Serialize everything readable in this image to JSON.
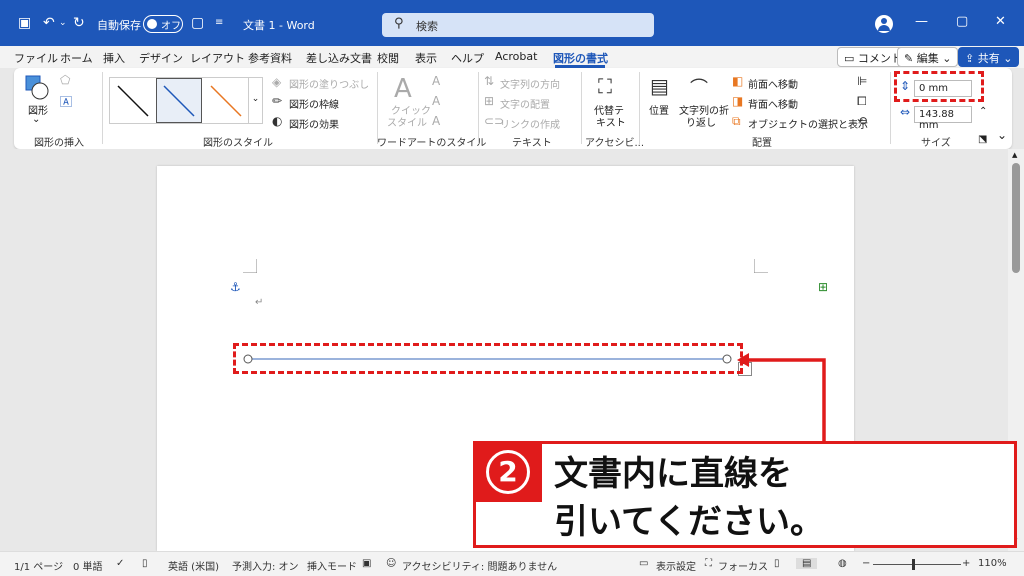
{
  "titlebar": {
    "autosave_label": "自動保存",
    "autosave_state": "オフ",
    "title": "文書 1 - Word",
    "search_placeholder": "検索"
  },
  "tabs": [
    "ファイル",
    "ホーム",
    "挿入",
    "デザイン",
    "レイアウト",
    "参考資料",
    "差し込み文書",
    "校閲",
    "表示",
    "ヘルプ",
    "Acrobat",
    "図形の書式"
  ],
  "active_tab": "図形の書式",
  "tab_buttons": {
    "comment": "コメント",
    "edit": "編集",
    "share": "共有"
  },
  "ribbon": {
    "insert_shapes": {
      "shapes_label": "図形",
      "group": "図形の挿入"
    },
    "shape_styles": {
      "fill": "図形の塗りつぶし",
      "outline": "図形の枠線",
      "effects": "図形の効果",
      "group": "図形のスタイル"
    },
    "wordart": {
      "quick_styles_1": "クイック",
      "quick_styles_2": "スタイル",
      "group": "ワードアートのスタイル"
    },
    "text": {
      "direction": "文字列の方向",
      "align": "文字の配置",
      "link": "リンクの作成",
      "group": "テキスト"
    },
    "accessibility": {
      "alt_text_1": "代替テ",
      "alt_text_2": "キスト",
      "group": "アクセシビ..."
    },
    "arrange": {
      "position": "位置",
      "wrap_1": "文字列の折",
      "wrap_2": "り返し",
      "bring_forward": "前面へ移動",
      "send_backward": "背面へ移動",
      "selection_pane": "オブジェクトの選択と表示",
      "group": "配置"
    },
    "size": {
      "height": "0 mm",
      "width": "143.88 mm",
      "group": "サイズ"
    }
  },
  "callout": {
    "number": "2",
    "line1": "文書内に直線を",
    "line2": "引いてください。"
  },
  "statusbar": {
    "page": "1/1 ページ",
    "words": "0 単語",
    "language": "英語 (米国)",
    "predict": "予測入力: オン",
    "insert_mode": "挿入モード",
    "accessibility": "アクセシビリティ: 問題ありません",
    "display_settings": "表示設定",
    "focus": "フォーカス",
    "zoom": "110%"
  },
  "colors": {
    "accent": "#1e57b9",
    "highlight": "#e01b1b"
  }
}
